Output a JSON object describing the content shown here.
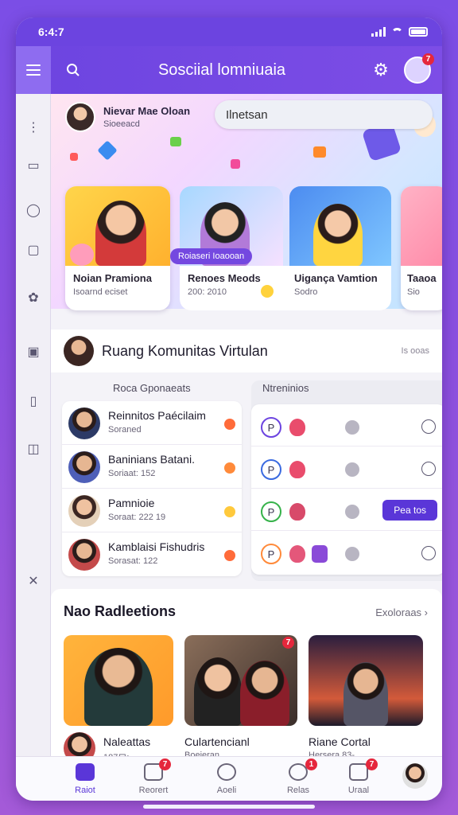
{
  "status": {
    "time": "6:4:7"
  },
  "appbar": {
    "title": "Sosciial lomniuaia",
    "notif_count": "7"
  },
  "hero": {
    "user_name": "Nievar Mae Oloan",
    "user_sub": "Sioeeacd",
    "search_value": "Ilnetsan"
  },
  "stories": [
    {
      "title": "Noian Pramiona",
      "meta": "Isoarnd eciset"
    },
    {
      "title": "Renoes Meods",
      "meta": "200: 2010",
      "chip": "Roiaseri Ioaooan"
    },
    {
      "title": "Uigança Vamtion",
      "meta": "Sodro"
    },
    {
      "title": "Taaoa",
      "meta": "Sio"
    }
  ],
  "community": {
    "title": "Ruang Komunitas Virtulan",
    "more": "Is ooas",
    "members_header": "Roca Gponaeats",
    "notifs_header": "Ntreninios",
    "members": [
      {
        "name": "Reinnitos Paécilaim",
        "sub": "Soraned"
      },
      {
        "name": "Baninians Batani.",
        "sub": "Soriaat: 152"
      },
      {
        "name": "Pamnioie",
        "sub": "Soraat: 222 19"
      },
      {
        "name": "Kamblaisi Fishudris",
        "sub": "Sorasat: 122"
      }
    ],
    "notifs": [
      {
        "letter": "P"
      },
      {
        "letter": "P"
      },
      {
        "letter": "P",
        "button": "Pea  tos"
      },
      {
        "letter": "P"
      }
    ]
  },
  "recs": {
    "title": "Nao Radleetions",
    "link": "Exoloraas",
    "items": [
      {
        "name": "Naleattas",
        "sub": "187ロ:"
      },
      {
        "name": "Culartencianl",
        "sub": "Boeieran"
      },
      {
        "name": "Riane Cortal",
        "sub": "Hersera 83-"
      }
    ]
  },
  "tabs": [
    {
      "label": "Raiot"
    },
    {
      "label": "Reorert",
      "badge": "7"
    },
    {
      "label": "Aoeli"
    },
    {
      "label": "Relas",
      "badge": "1"
    },
    {
      "label": "Uraal",
      "badge": "7"
    }
  ]
}
